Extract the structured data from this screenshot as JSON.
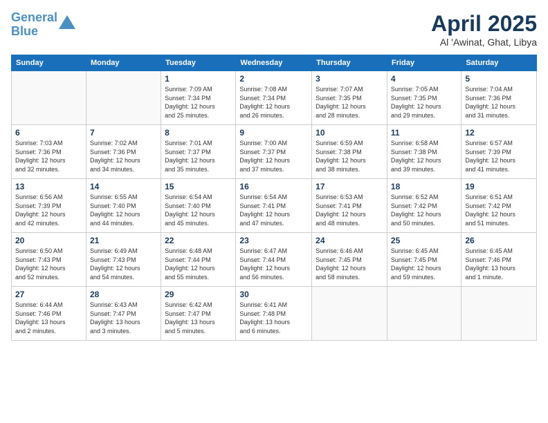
{
  "header": {
    "logo_line1": "General",
    "logo_line2": "Blue",
    "month": "April 2025",
    "location": "Al 'Awinat, Ghat, Libya"
  },
  "weekdays": [
    "Sunday",
    "Monday",
    "Tuesday",
    "Wednesday",
    "Thursday",
    "Friday",
    "Saturday"
  ],
  "weeks": [
    [
      {
        "day": "",
        "info": ""
      },
      {
        "day": "",
        "info": ""
      },
      {
        "day": "1",
        "info": "Sunrise: 7:09 AM\nSunset: 7:34 PM\nDaylight: 12 hours\nand 25 minutes."
      },
      {
        "day": "2",
        "info": "Sunrise: 7:08 AM\nSunset: 7:34 PM\nDaylight: 12 hours\nand 26 minutes."
      },
      {
        "day": "3",
        "info": "Sunrise: 7:07 AM\nSunset: 7:35 PM\nDaylight: 12 hours\nand 28 minutes."
      },
      {
        "day": "4",
        "info": "Sunrise: 7:05 AM\nSunset: 7:35 PM\nDaylight: 12 hours\nand 29 minutes."
      },
      {
        "day": "5",
        "info": "Sunrise: 7:04 AM\nSunset: 7:36 PM\nDaylight: 12 hours\nand 31 minutes."
      }
    ],
    [
      {
        "day": "6",
        "info": "Sunrise: 7:03 AM\nSunset: 7:36 PM\nDaylight: 12 hours\nand 32 minutes."
      },
      {
        "day": "7",
        "info": "Sunrise: 7:02 AM\nSunset: 7:36 PM\nDaylight: 12 hours\nand 34 minutes."
      },
      {
        "day": "8",
        "info": "Sunrise: 7:01 AM\nSunset: 7:37 PM\nDaylight: 12 hours\nand 35 minutes."
      },
      {
        "day": "9",
        "info": "Sunrise: 7:00 AM\nSunset: 7:37 PM\nDaylight: 12 hours\nand 37 minutes."
      },
      {
        "day": "10",
        "info": "Sunrise: 6:59 AM\nSunset: 7:38 PM\nDaylight: 12 hours\nand 38 minutes."
      },
      {
        "day": "11",
        "info": "Sunrise: 6:58 AM\nSunset: 7:38 PM\nDaylight: 12 hours\nand 39 minutes."
      },
      {
        "day": "12",
        "info": "Sunrise: 6:57 AM\nSunset: 7:39 PM\nDaylight: 12 hours\nand 41 minutes."
      }
    ],
    [
      {
        "day": "13",
        "info": "Sunrise: 6:56 AM\nSunset: 7:39 PM\nDaylight: 12 hours\nand 42 minutes."
      },
      {
        "day": "14",
        "info": "Sunrise: 6:55 AM\nSunset: 7:40 PM\nDaylight: 12 hours\nand 44 minutes."
      },
      {
        "day": "15",
        "info": "Sunrise: 6:54 AM\nSunset: 7:40 PM\nDaylight: 12 hours\nand 45 minutes."
      },
      {
        "day": "16",
        "info": "Sunrise: 6:54 AM\nSunset: 7:41 PM\nDaylight: 12 hours\nand 47 minutes."
      },
      {
        "day": "17",
        "info": "Sunrise: 6:53 AM\nSunset: 7:41 PM\nDaylight: 12 hours\nand 48 minutes."
      },
      {
        "day": "18",
        "info": "Sunrise: 6:52 AM\nSunset: 7:42 PM\nDaylight: 12 hours\nand 50 minutes."
      },
      {
        "day": "19",
        "info": "Sunrise: 6:51 AM\nSunset: 7:42 PM\nDaylight: 12 hours\nand 51 minutes."
      }
    ],
    [
      {
        "day": "20",
        "info": "Sunrise: 6:50 AM\nSunset: 7:43 PM\nDaylight: 12 hours\nand 52 minutes."
      },
      {
        "day": "21",
        "info": "Sunrise: 6:49 AM\nSunset: 7:43 PM\nDaylight: 12 hours\nand 54 minutes."
      },
      {
        "day": "22",
        "info": "Sunrise: 6:48 AM\nSunset: 7:44 PM\nDaylight: 12 hours\nand 55 minutes."
      },
      {
        "day": "23",
        "info": "Sunrise: 6:47 AM\nSunset: 7:44 PM\nDaylight: 12 hours\nand 56 minutes."
      },
      {
        "day": "24",
        "info": "Sunrise: 6:46 AM\nSunset: 7:45 PM\nDaylight: 12 hours\nand 58 minutes."
      },
      {
        "day": "25",
        "info": "Sunrise: 6:45 AM\nSunset: 7:45 PM\nDaylight: 12 hours\nand 59 minutes."
      },
      {
        "day": "26",
        "info": "Sunrise: 6:45 AM\nSunset: 7:46 PM\nDaylight: 13 hours\nand 1 minute."
      }
    ],
    [
      {
        "day": "27",
        "info": "Sunrise: 6:44 AM\nSunset: 7:46 PM\nDaylight: 13 hours\nand 2 minutes."
      },
      {
        "day": "28",
        "info": "Sunrise: 6:43 AM\nSunset: 7:47 PM\nDaylight: 13 hours\nand 3 minutes."
      },
      {
        "day": "29",
        "info": "Sunrise: 6:42 AM\nSunset: 7:47 PM\nDaylight: 13 hours\nand 5 minutes."
      },
      {
        "day": "30",
        "info": "Sunrise: 6:41 AM\nSunset: 7:48 PM\nDaylight: 13 hours\nand 6 minutes."
      },
      {
        "day": "",
        "info": ""
      },
      {
        "day": "",
        "info": ""
      },
      {
        "day": "",
        "info": ""
      }
    ]
  ]
}
